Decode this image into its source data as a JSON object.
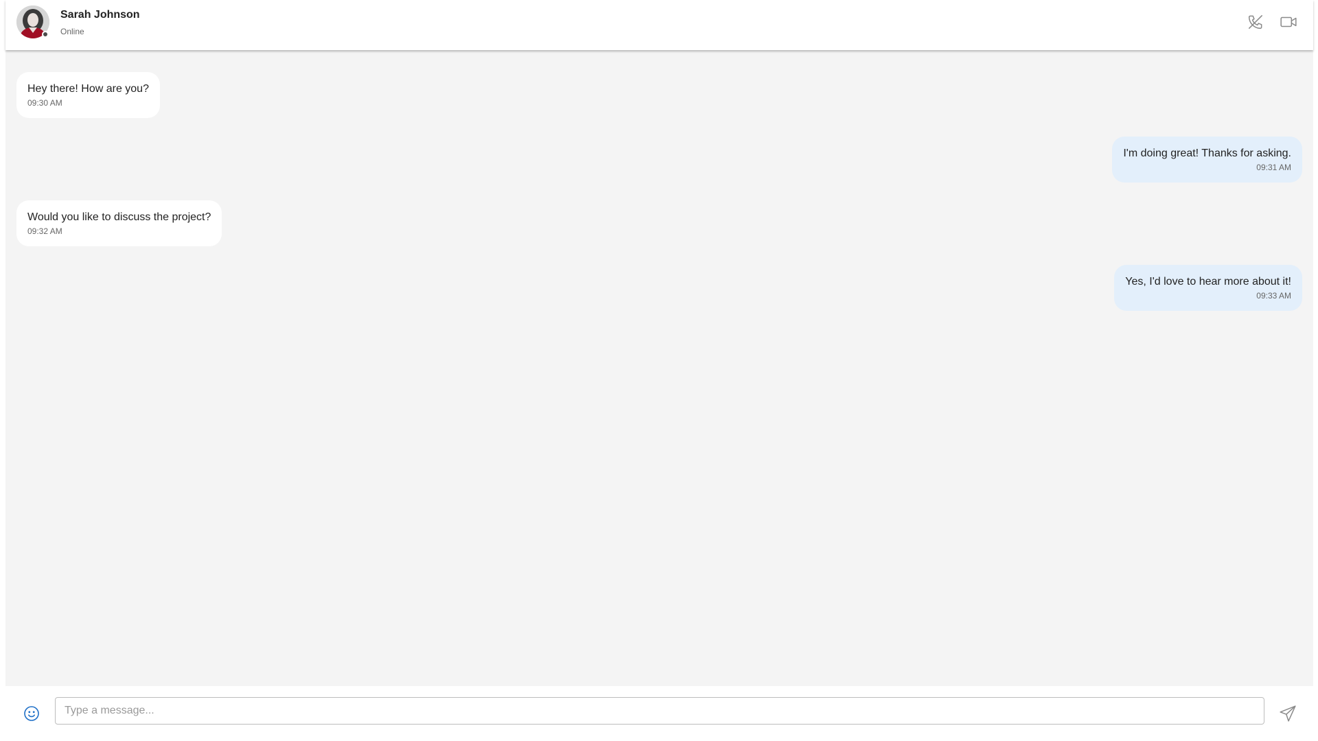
{
  "header": {
    "contact_name": "Sarah Johnson",
    "contact_status": "Online",
    "call_icon": "phone-off-icon",
    "video_icon": "video-camera-icon"
  },
  "messages": [
    {
      "direction": "incoming",
      "text": "Hey there! How are you?",
      "time": "09:30 AM"
    },
    {
      "direction": "outgoing",
      "text": "I'm doing great! Thanks for asking.",
      "time": "09:31 AM"
    },
    {
      "direction": "incoming",
      "text": "Would you like to discuss the project?",
      "time": "09:32 AM"
    },
    {
      "direction": "outgoing",
      "text": "Yes, I'd love to hear more about it!",
      "time": "09:33 AM"
    }
  ],
  "composer": {
    "placeholder": "Type a message...",
    "value": "",
    "emoji_icon": "smiley-icon",
    "send_icon": "send-icon"
  },
  "colors": {
    "chat_background": "#f4f4f4",
    "outgoing_bubble": "#e3effb",
    "incoming_bubble": "#ffffff",
    "emoji_accent": "#1e6fc7",
    "icon_gray": "#8a8a8a"
  }
}
